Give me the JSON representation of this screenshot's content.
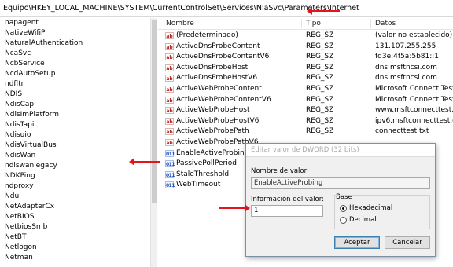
{
  "address_bar": {
    "path": "Equipo\\HKEY_LOCAL_MACHINE\\SYSTEM\\CurrentControlSet\\Services\\NlaSvc\\Parameters\\Internet"
  },
  "tree": {
    "items": [
      "napagent",
      "NativeWifiP",
      "NaturalAuthentication",
      "NcaSvc",
      "NcbService",
      "NcdAutoSetup",
      "ndfltr",
      "NDIS",
      "NdisCap",
      "NdisImPlatform",
      "NdisTapi",
      "Ndisuio",
      "NdisVirtualBus",
      "NdisWan",
      "ndiswanlegacy",
      "NDKPing",
      "ndproxy",
      "Ndu",
      "NetAdapterCx",
      "NetBIOS",
      "NetbiosSmb",
      "NetBT",
      "Netlogon",
      "Netman"
    ]
  },
  "list": {
    "columns": {
      "name": "Nombre",
      "type": "Tipo",
      "data": "Datos"
    },
    "rows": [
      {
        "icon": "string-value-icon",
        "name": "(Predeterminado)",
        "type": "REG_SZ",
        "data": "(valor no establecido)"
      },
      {
        "icon": "string-value-icon",
        "name": "ActiveDnsProbeContent",
        "type": "REG_SZ",
        "data": "131.107.255.255"
      },
      {
        "icon": "string-value-icon",
        "name": "ActiveDnsProbeContentV6",
        "type": "REG_SZ",
        "data": "fd3e:4f5a:5b81::1"
      },
      {
        "icon": "string-value-icon",
        "name": "ActiveDnsProbeHost",
        "type": "REG_SZ",
        "data": "dns.msftncsi.com"
      },
      {
        "icon": "string-value-icon",
        "name": "ActiveDnsProbeHostV6",
        "type": "REG_SZ",
        "data": "dns.msftncsi.com"
      },
      {
        "icon": "string-value-icon",
        "name": "ActiveWebProbeContent",
        "type": "REG_SZ",
        "data": "Microsoft Connect Test"
      },
      {
        "icon": "string-value-icon",
        "name": "ActiveWebProbeContentV6",
        "type": "REG_SZ",
        "data": "Microsoft Connect Test"
      },
      {
        "icon": "string-value-icon",
        "name": "ActiveWebProbeHost",
        "type": "REG_SZ",
        "data": "www.msftconnecttest.com"
      },
      {
        "icon": "string-value-icon",
        "name": "ActiveWebProbeHostV6",
        "type": "REG_SZ",
        "data": "ipv6.msftconnecttest.com"
      },
      {
        "icon": "string-value-icon",
        "name": "ActiveWebProbePath",
        "type": "REG_SZ",
        "data": "connecttest.txt"
      },
      {
        "icon": "string-value-icon",
        "name": "ActiveWebProbePathV6",
        "type": "",
        "data": ""
      },
      {
        "icon": "dword-value-icon",
        "name": "EnableActiveProbing",
        "type": "",
        "data": ""
      },
      {
        "icon": "dword-value-icon",
        "name": "PassivePollPeriod",
        "type": "",
        "data": ""
      },
      {
        "icon": "dword-value-icon",
        "name": "StaleThreshold",
        "type": "",
        "data": ""
      },
      {
        "icon": "dword-value-icon",
        "name": "WebTimeout",
        "type": "",
        "data": ""
      }
    ]
  },
  "dialog": {
    "title": "Editar valor de DWORD (32 bits)",
    "name_label": "Nombre de valor:",
    "name_value": "EnableActiveProbing",
    "data_label": "Información del valor:",
    "data_value": "1",
    "base_label": "Base",
    "base_options": [
      "Hexadecimal",
      "Decimal"
    ],
    "base_selected": "Hexadecimal",
    "ok_label": "Aceptar",
    "cancel_label": "Cancelar"
  },
  "icons": {
    "sz_glyph": "ab",
    "dword_glyph": "011"
  },
  "colors": {
    "annotation_arrow": "#e3141b",
    "dialog_border": "#7a8fa8"
  }
}
